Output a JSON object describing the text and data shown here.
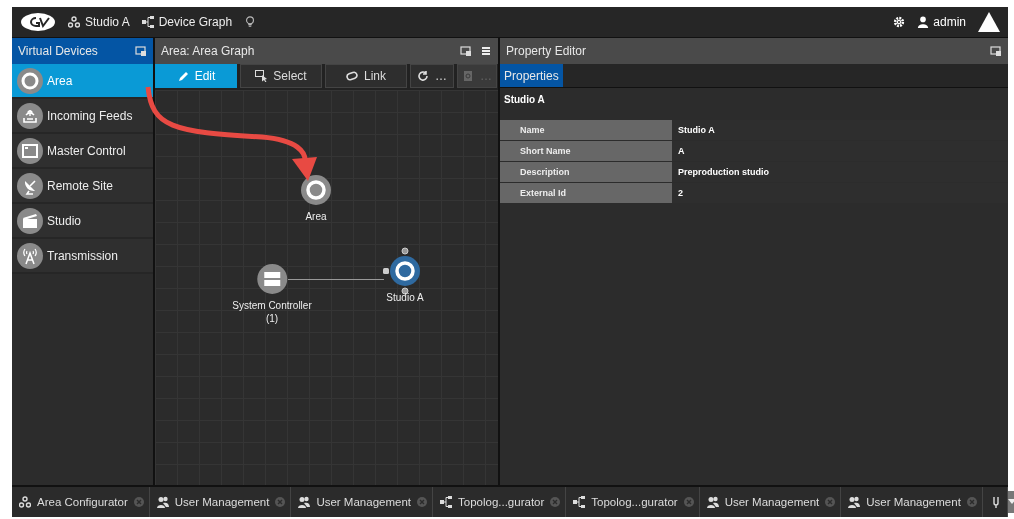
{
  "top_bar": {
    "breadcrumbs": [
      {
        "kind": "area",
        "label": "Studio A"
      },
      {
        "kind": "graph",
        "label": "Device Graph"
      }
    ],
    "user": "admin"
  },
  "virtual_devices": {
    "title": "Virtual Devices",
    "items": [
      {
        "kind": "area",
        "label": "Area",
        "selected": true
      },
      {
        "kind": "feeds",
        "label": "Incoming Feeds",
        "selected": false
      },
      {
        "kind": "monitor",
        "label": "Master Control",
        "selected": false
      },
      {
        "kind": "satellite",
        "label": "Remote Site",
        "selected": false
      },
      {
        "kind": "clapper",
        "label": "Studio",
        "selected": false
      },
      {
        "kind": "antenna",
        "label": "Transmission",
        "selected": false
      }
    ]
  },
  "area_graph": {
    "title": "Area: Area Graph",
    "toolbar": [
      {
        "kind": "edit",
        "label": "Edit",
        "selected": true,
        "disabled": false
      },
      {
        "kind": "select",
        "label": "Select",
        "selected": false,
        "disabled": false
      },
      {
        "kind": "link",
        "label": "Link",
        "selected": false,
        "disabled": false
      },
      {
        "kind": "refresh",
        "label": "…",
        "selected": false,
        "disabled": false
      },
      {
        "kind": "trash",
        "label": "…",
        "selected": false,
        "disabled": true
      }
    ],
    "nodes": [
      {
        "kind": "area",
        "label": "Area",
        "selected": false
      },
      {
        "kind": "server",
        "label": "System Controller\n(1)",
        "selected": false
      },
      {
        "kind": "area",
        "label": "Studio A",
        "selected": true
      }
    ]
  },
  "property_editor": {
    "title": "Property Editor",
    "tabs": [
      {
        "label": "Properties",
        "selected": true
      }
    ],
    "heading": "Studio A",
    "rows": [
      {
        "name": "Name",
        "value": "Studio A"
      },
      {
        "name": "Short Name",
        "value": "A"
      },
      {
        "name": "Description",
        "value": "Preproduction studio"
      },
      {
        "name": "External Id",
        "value": "2"
      }
    ]
  },
  "bottom_tabs": [
    {
      "kind": "area",
      "label": "Area Configurator"
    },
    {
      "kind": "users",
      "label": "User Management"
    },
    {
      "kind": "users",
      "label": "User Management"
    },
    {
      "kind": "graph",
      "label": "Topolog...gurator"
    },
    {
      "kind": "graph",
      "label": "Topolog...gurator"
    },
    {
      "kind": "users",
      "label": "User Management"
    },
    {
      "kind": "users",
      "label": "User Management"
    },
    {
      "kind": "tool"
    }
  ]
}
